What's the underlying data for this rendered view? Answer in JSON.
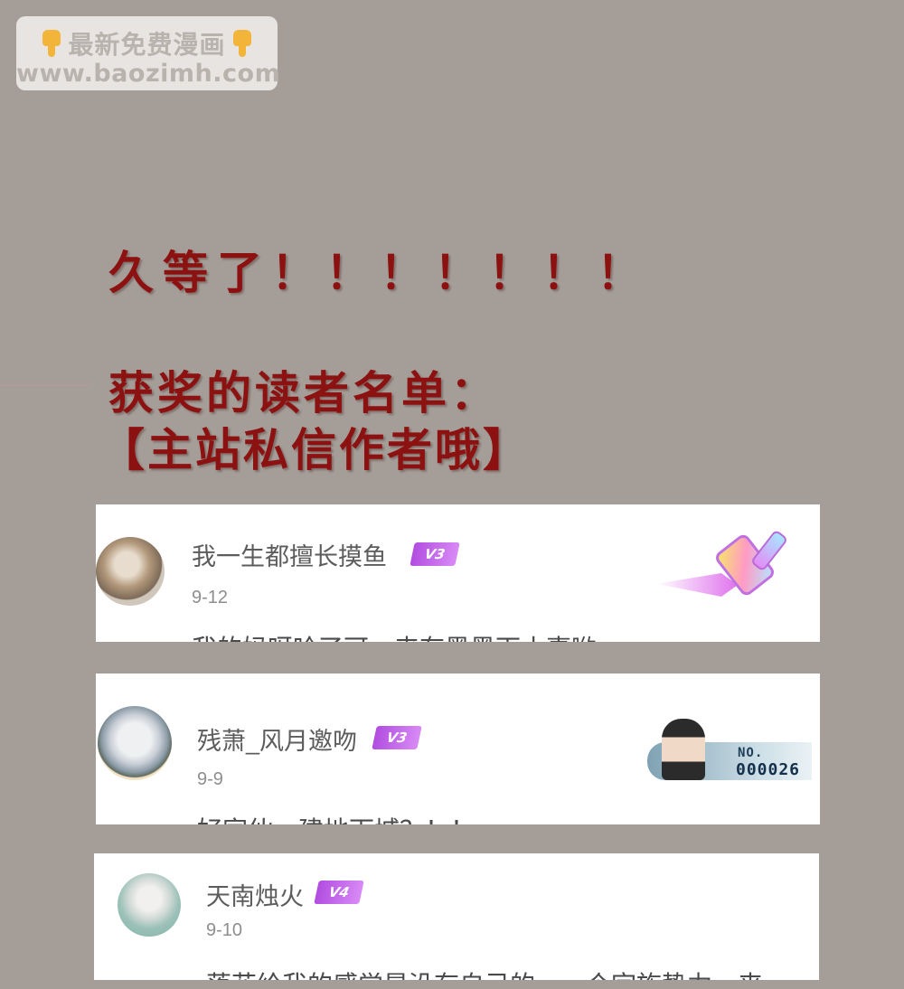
{
  "watermark": {
    "line1": "最新免费漫画",
    "line2": "www.baozimh.com",
    "icon": "pointing-down-hand-icon"
  },
  "headings": {
    "wait": "久等了！！！！！！！",
    "winners": "获奖的读者名单：",
    "instruction": "【主站私信作者哦】"
  },
  "comments": [
    {
      "username": "我一生都擅长摸鱼",
      "vip": "V3",
      "date": "9-12",
      "text": "我的妈呀哈了可，来有黑黑下小事哟",
      "badge": "paintbrush-badge-icon"
    },
    {
      "username": "残萧_风月邀吻",
      "vip": "V3",
      "date": "9-9",
      "text": "好家伙，建地下城？！！",
      "badge": {
        "label": "NO.",
        "number": "000026"
      }
    },
    {
      "username": "天南烛火",
      "vip": "V4",
      "date": "9-10",
      "text": "落花给我的感觉是没有自己的，一个宗族势力，来"
    }
  ],
  "colors": {
    "background": "#a59e98",
    "heading": "#8c1212",
    "vip_badge": "#b14de0"
  }
}
